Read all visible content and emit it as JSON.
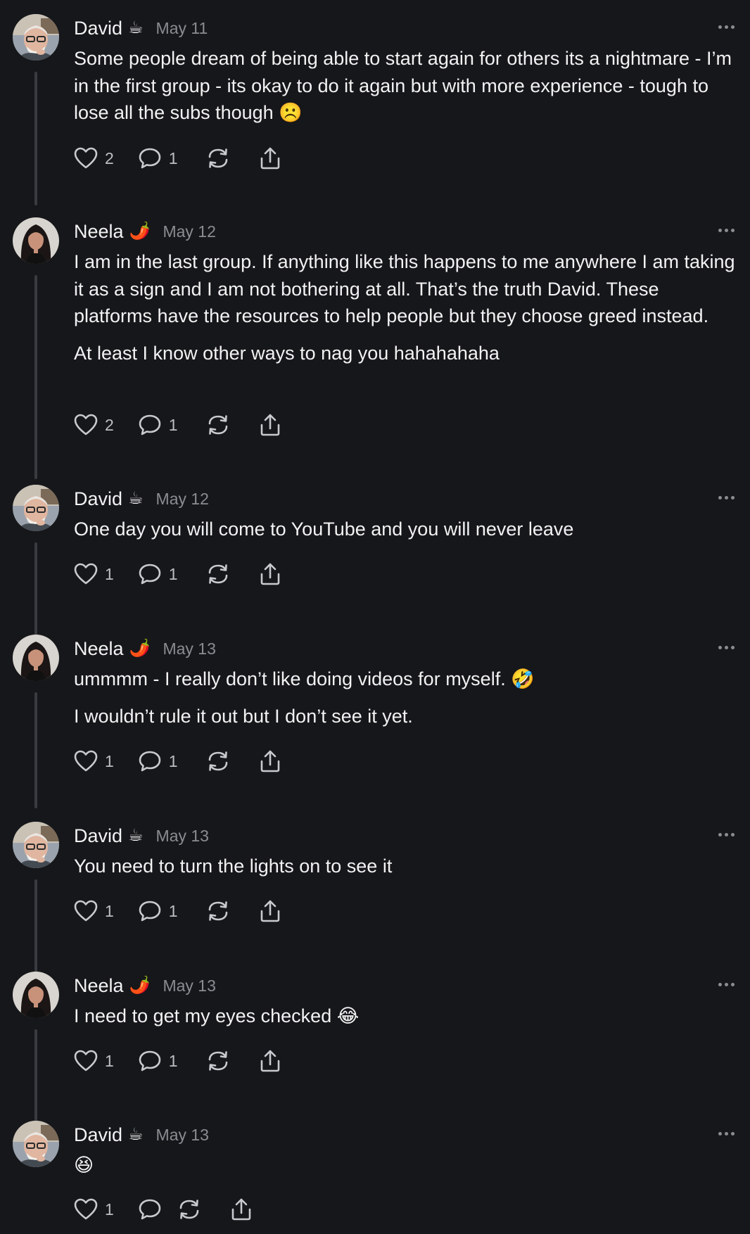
{
  "theme": {
    "background": "#16171a",
    "text": "#f2f2f3",
    "muted": "#8b8c92",
    "thread_line": "#3a3b40"
  },
  "comments": [
    {
      "author": "David",
      "badge": "☕",
      "badge_icon": "coffee-icon",
      "date": "May 11",
      "paragraphs": [
        "Some people dream of being able to start again for others its a nightmare - I’m in the first group - its okay to do it again but with more experience - tough to lose all the subs though ☹️"
      ],
      "likes": "2",
      "replies": "1",
      "avatar": "david"
    },
    {
      "author": "Neela",
      "badge": "🌶️",
      "badge_icon": "chili-pepper-icon",
      "date": "May 12",
      "paragraphs": [
        "I am in the last group. If anything like this happens to me anywhere I am taking it as a sign and I am not bothering at all. That’s the truth David. These platforms have the resources to help people but they choose greed instead.",
        "At least I know other ways to nag you hahahahaha"
      ],
      "likes": "2",
      "replies": "1",
      "avatar": "neela"
    },
    {
      "author": "David",
      "badge": "☕",
      "badge_icon": "coffee-icon",
      "date": "May 12",
      "paragraphs": [
        "One day you will come to YouTube and you will never leave"
      ],
      "likes": "1",
      "replies": "1",
      "avatar": "david"
    },
    {
      "author": "Neela",
      "badge": "🌶️",
      "badge_icon": "chili-pepper-icon",
      "date": "May 13",
      "paragraphs": [
        "ummmm - I really don’t like doing videos for myself. 🤣",
        "I wouldn’t rule it out but I don’t see it yet."
      ],
      "likes": "1",
      "replies": "1",
      "avatar": "neela"
    },
    {
      "author": "David",
      "badge": "☕",
      "badge_icon": "coffee-icon",
      "date": "May 13",
      "paragraphs": [
        "You need to turn the lights on to see it"
      ],
      "likes": "1",
      "replies": "1",
      "avatar": "david"
    },
    {
      "author": "Neela",
      "badge": "🌶️",
      "badge_icon": "chili-pepper-icon",
      "date": "May 13",
      "paragraphs": [
        "I need to get my eyes checked 😂"
      ],
      "likes": "1",
      "replies": "1",
      "avatar": "neela"
    },
    {
      "author": "David",
      "badge": "☕",
      "badge_icon": "coffee-icon",
      "date": "May 13",
      "paragraphs": [
        "😆"
      ],
      "likes": "1",
      "replies": "",
      "avatar": "david"
    }
  ]
}
